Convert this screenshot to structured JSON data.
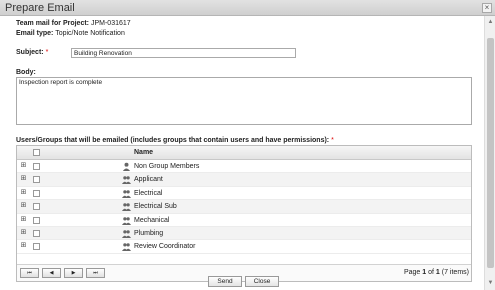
{
  "dialog": {
    "title": "Prepare Email",
    "close_glyph": "×"
  },
  "info": {
    "project_label": "Team mail for Project:",
    "project_value": "JPM-031617",
    "type_label": "Email type:",
    "type_value": "Topic/Note Notification"
  },
  "subject": {
    "label": "Subject:",
    "required": "*",
    "value": "Building Renovation"
  },
  "body": {
    "label": "Body:",
    "value": "Inspection report is complete"
  },
  "users_section": {
    "label": "Users/Groups that will be emailed (includes groups that contain users and have permissions):",
    "required": "*"
  },
  "grid": {
    "column_name": "Name",
    "rows": [
      {
        "name": "Non Group Members",
        "icon": "user-icon"
      },
      {
        "name": "Applicant",
        "icon": "group-icon"
      },
      {
        "name": "Electrical",
        "icon": "group-icon"
      },
      {
        "name": "Electrical Sub",
        "icon": "group-icon"
      },
      {
        "name": "Mechanical",
        "icon": "group-icon"
      },
      {
        "name": "Plumbing",
        "icon": "group-icon"
      },
      {
        "name": "Review Coordinator",
        "icon": "group-icon"
      }
    ]
  },
  "pager": {
    "first": "⏮",
    "prev": "◀",
    "next": "▶",
    "last": "⏭",
    "info_prefix": "Page",
    "page": "1",
    "of_text": "of",
    "total_pages": "1",
    "items_text": "(7 items)"
  },
  "actions": {
    "send_label": "Send",
    "close_label": "Close"
  },
  "colors": {
    "required": "#dd0000",
    "header_bg": "#d8d8d8"
  }
}
